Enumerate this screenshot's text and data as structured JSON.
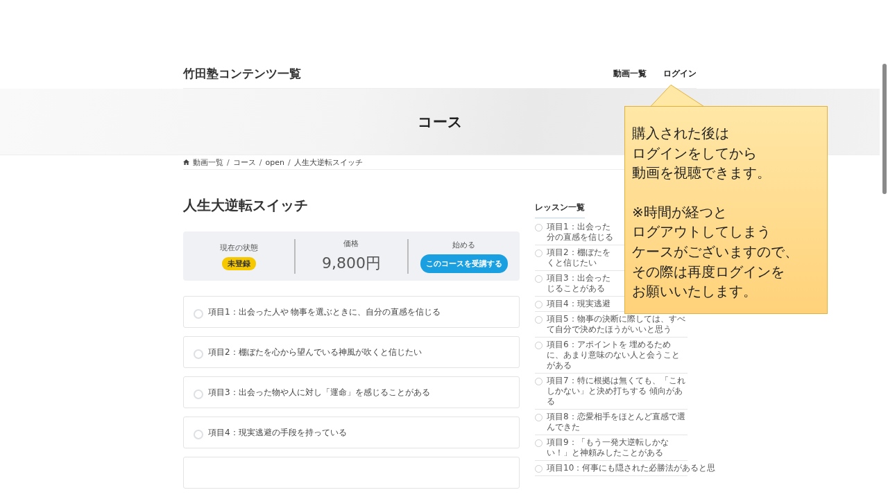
{
  "header": {
    "site_title": "竹田塾コンテンツ一覧",
    "nav": [
      "動画一覧",
      "ログイン"
    ]
  },
  "hero": {
    "title": "コース"
  },
  "breadcrumb": [
    {
      "kind": "link",
      "text": "動画一覧"
    },
    {
      "kind": "separator",
      "text": "/"
    },
    {
      "kind": "link",
      "text": "コース"
    },
    {
      "kind": "separator",
      "text": "/"
    },
    {
      "kind": "link",
      "text": "open"
    },
    {
      "kind": "separator",
      "text": "/"
    },
    {
      "kind": "current",
      "text": "人生大逆転スイッチ"
    }
  ],
  "course": {
    "title": "人生大逆転スイッチ",
    "status": {
      "label": "現在の状態",
      "badge": "未登録"
    },
    "price": {
      "label": "価格",
      "value": "9,800円"
    },
    "start": {
      "label": "始める",
      "button": "このコースを受講する"
    },
    "items": [
      {
        "kind": "lesson",
        "text": "項目1：出会った人や 物事を選ぶときに、自分の直感を信じる",
        "completed": false
      },
      {
        "kind": "lesson",
        "text": "項目2：棚ぼたを心から望んでいる神風が吹くと信じたい",
        "completed": false
      },
      {
        "kind": "lesson",
        "text": "項目3：出会った物や人に対し「運命」を感じることがある",
        "completed": false
      },
      {
        "kind": "lesson",
        "text": "項目4：現実逃避の手段を持っている",
        "completed": false
      },
      {
        "kind": "blank"
      }
    ]
  },
  "sidebar": {
    "title": "レッスン一覧",
    "lessons": [
      {
        "lines": [
          "項目1：出会った",
          "分の直感を信じる"
        ],
        "completed": false
      },
      {
        "lines": [
          "項目2：棚ぼたを",
          "くと信じたい"
        ],
        "completed": false
      },
      {
        "lines": [
          "項目3：出会った",
          "じることがある"
        ],
        "completed": false
      },
      {
        "lines": [
          "項目4：現実逃避"
        ],
        "completed": false
      },
      {
        "lines": [
          "項目5：物事の決断に際しては、すべて自分で決めたほうがいいと思う"
        ],
        "completed": false
      },
      {
        "lines": [
          "項目6：アポイントを 埋めるために、あまり意味のない人と会うことがある"
        ],
        "completed": false
      },
      {
        "lines": [
          "項目7：特に根拠は無くても、「これしかない」と決め打ちする 傾向がある"
        ],
        "completed": false
      },
      {
        "lines": [
          "項目8：恋愛相手をほとんど直感で選んできた"
        ],
        "completed": false
      },
      {
        "lines": [
          "項目9：「もう一発大逆転しかない！」と神頼みしたことがある"
        ],
        "completed": false
      },
      {
        "lines": [
          "項目10：何事にも隠された必勝法があると思"
        ],
        "completed": false
      }
    ]
  },
  "callout": {
    "paragraphs": [
      [
        "購入された後は",
        "ログインをしてから",
        "動画を視聴できます。"
      ],
      [
        "※時間が経つと",
        "ログアウトしてしまう",
        "ケースがございますので、",
        "その際は再度ログインを",
        "お願いいたします。"
      ]
    ]
  }
}
